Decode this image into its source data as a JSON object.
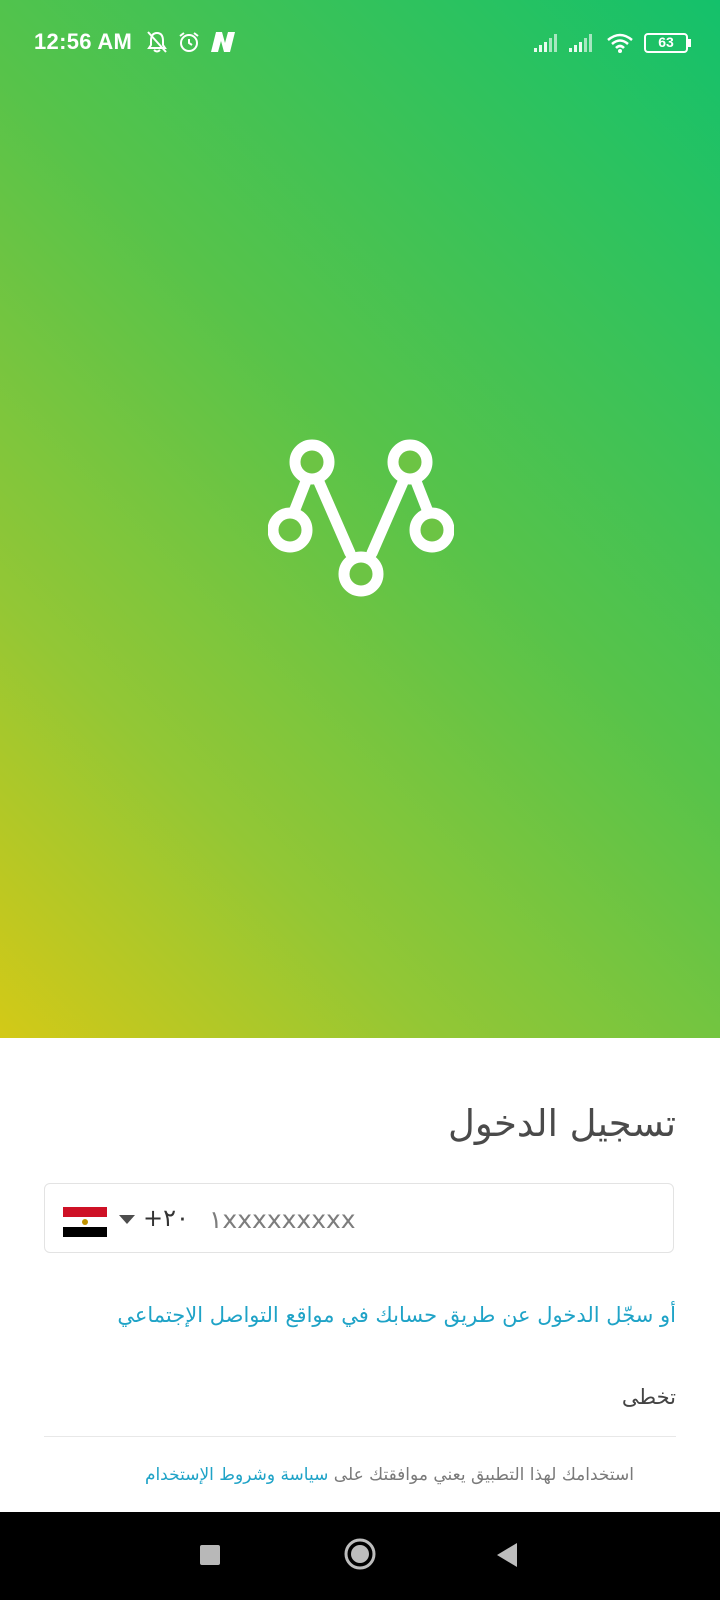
{
  "status_bar": {
    "time": "12:56 AM",
    "battery": "63",
    "icons": [
      "mute-icon",
      "alarm-icon",
      "notification-app-icon",
      "signal-icon",
      "signal-icon",
      "wifi-icon",
      "battery-icon"
    ]
  },
  "colors": {
    "gradient_start": "#14c16b",
    "gradient_end": "#d3c917",
    "accent_link": "#1fa3c7"
  },
  "login": {
    "title": "تسجيل الدخول",
    "country_code": "+٢٠",
    "phone_placeholder": "١xxxxxxxxx",
    "country_flag": "egypt-flag",
    "social_login_link": "أو سجّل الدخول عن طريق حسابك في مواقع التواصل الإجتماعي",
    "skip_label": "تخطى",
    "terms_text": "استخدامك لهذا التطبيق يعني موافقتك على",
    "terms_link": "سياسة وشروط الإستخدام"
  },
  "nav_bar": {
    "icons": [
      "recents-icon",
      "home-icon",
      "back-icon"
    ]
  }
}
